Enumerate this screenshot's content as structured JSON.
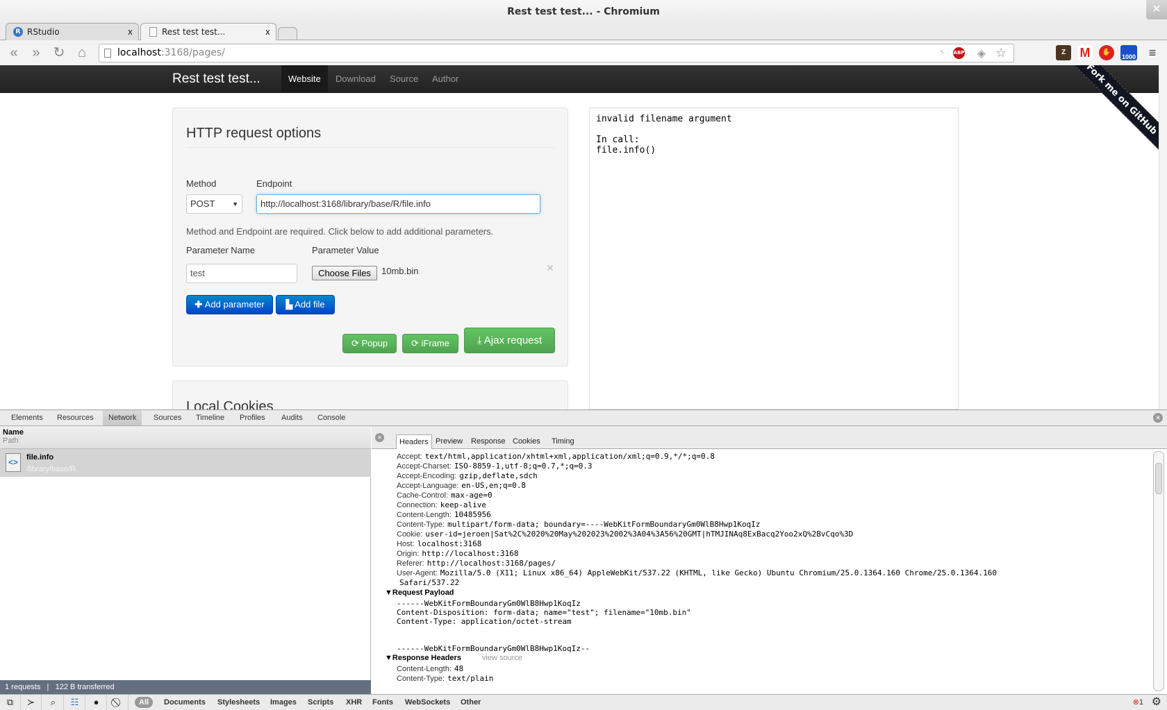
{
  "window": {
    "title": "Rest test test... - Chromium",
    "close": "✕"
  },
  "tabs": [
    {
      "label": "RStudio",
      "icon": "R",
      "close": "x"
    },
    {
      "label": "Rest test test...",
      "close": "x"
    }
  ],
  "address": {
    "host": "localhost",
    "rest": ":3168/pages/"
  },
  "extensions": {
    "abp": "ABP",
    "gcount": "1000"
  },
  "site": {
    "brand": "Rest test test...",
    "nav": [
      "Website",
      "Download",
      "Source",
      "Author"
    ],
    "ribbon": "Fork me on GitHub"
  },
  "form": {
    "title": "HTTP request options",
    "method_label": "Method",
    "method_value": "POST",
    "endpoint_label": "Endpoint",
    "endpoint_value": "http://localhost:3168/library/base/R/file.info",
    "hint": "Method and Endpoint are required. Click below to add additional parameters.",
    "param_name_label": "Parameter Name",
    "param_value_label": "Parameter Value",
    "param_name": "test",
    "choose_files": "Choose Files",
    "file_name": "10mb.bin",
    "remove": "✕",
    "add_parameter": "Add parameter",
    "add_file": "Add file",
    "popup": "Popup",
    "iframe": "iFrame",
    "ajax": "Ajax request",
    "next_section": "Local Cookies"
  },
  "result": "invalid filename argument\n\nIn call:\nfile.info()",
  "devtools": {
    "tabs": [
      "Elements",
      "Resources",
      "Network",
      "Sources",
      "Timeline",
      "Profiles",
      "Audits",
      "Console"
    ],
    "active_tab": "Network",
    "col_name": "Name",
    "col_path": "Path",
    "request": {
      "name": "file.info",
      "path": "/library/base/R"
    },
    "status": {
      "requests": "1 requests",
      "transferred": "122 B transferred",
      "sep": "|"
    },
    "subtabs": [
      "Headers",
      "Preview",
      "Response",
      "Cookies",
      "Timing"
    ],
    "request_headers": [
      [
        "Accept:",
        "text/html,application/xhtml+xml,application/xml;q=0.9,*/*;q=0.8"
      ],
      [
        "Accept-Charset:",
        "ISO-8859-1,utf-8;q=0.7,*;q=0.3"
      ],
      [
        "Accept-Encoding:",
        "gzip,deflate,sdch"
      ],
      [
        "Accept-Language:",
        "en-US,en;q=0.8"
      ],
      [
        "Cache-Control:",
        "max-age=0"
      ],
      [
        "Connection:",
        "keep-alive"
      ],
      [
        "Content-Length:",
        "10485956"
      ],
      [
        "Content-Type:",
        "multipart/form-data; boundary=----WebKitFormBoundaryGm0WlB8Hwp1KoqIz"
      ],
      [
        "Cookie:",
        "user-id=jeroen|Sat%2C%2020%20May%202023%2002%3A04%3A56%20GMT|hTMJINAq8ExBacq2Yoo2xQ%2BvCqo%3D"
      ],
      [
        "Host:",
        "localhost:3168"
      ],
      [
        "Origin:",
        "http://localhost:3168"
      ],
      [
        "Referer:",
        "http://localhost:3168/pages/"
      ],
      [
        "User-Agent:",
        "Mozilla/5.0 (X11; Linux x86_64) AppleWebKit/537.22 (KHTML, like Gecko) Ubuntu Chromium/25.0.1364.160 Chrome/25.0.1364.160"
      ],
      [
        "",
        "Safari/537.22"
      ]
    ],
    "payload_title": "Request Payload",
    "payload": [
      "------WebKitFormBoundaryGm0WlB8Hwp1KoqIz",
      "Content-Disposition: form-data; name=\"test\"; filename=\"10mb.bin\"",
      "Content-Type: application/octet-stream",
      "",
      "",
      "------WebKitFormBoundaryGm0WlB8Hwp1KoqIz--"
    ],
    "response_title": "Response Headers",
    "view_source": "view source",
    "response_headers": [
      [
        "Content-Length:",
        "48"
      ],
      [
        "Content-Type:",
        "text/plain"
      ]
    ],
    "filters": [
      "All",
      "Documents",
      "Stylesheets",
      "Images",
      "Scripts",
      "XHR",
      "Fonts",
      "WebSockets",
      "Other"
    ],
    "error_count": "1"
  }
}
